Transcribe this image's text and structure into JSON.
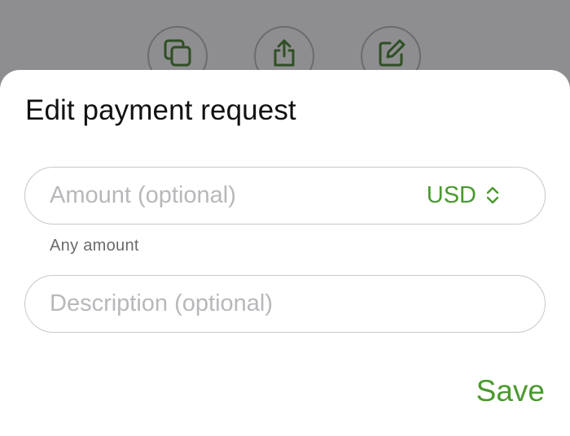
{
  "background_actions": [
    {
      "icon": "copy-icon"
    },
    {
      "icon": "share-icon"
    },
    {
      "icon": "edit-icon"
    }
  ],
  "sheet": {
    "title": "Edit payment request",
    "amount_field": {
      "placeholder": "Amount (optional)",
      "value": ""
    },
    "currency": {
      "label": "USD",
      "icon": "chevron-up-down-icon"
    },
    "amount_hint": "Any amount",
    "description_field": {
      "placeholder": "Description (optional)",
      "value": ""
    },
    "save_label": "Save"
  },
  "colors": {
    "accent": "#4a9a2e",
    "backdrop": "#8e8e90",
    "icon_dim": "#2f4f24"
  }
}
